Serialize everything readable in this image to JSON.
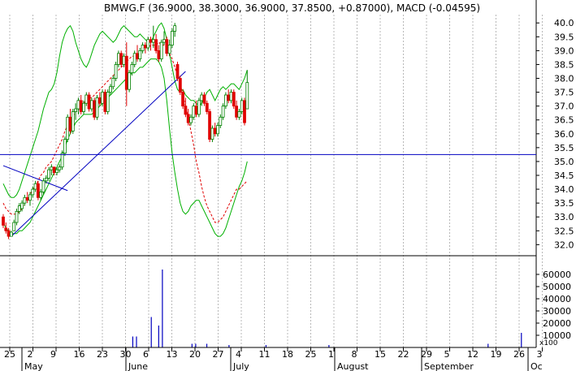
{
  "chart_data": {
    "type": "candlestick",
    "title": "BMWG.F (36.9000, 38.3000, 36.9000, 37.8500, +0.87000), MACD (-0.04595)",
    "ylim": [
      31.6,
      40.3
    ],
    "volume_ylim": [
      0,
      72000
    ],
    "volume_unit_label": "x100",
    "y_ticks": [
      "40.0",
      "39.5",
      "39.0",
      "38.5",
      "38.0",
      "37.5",
      "37.0",
      "36.5",
      "36.0",
      "35.5",
      "35.0",
      "34.5",
      "34.0",
      "33.5",
      "33.0",
      "32.5",
      "32.0"
    ],
    "volume_ticks": [
      "60000",
      "50000",
      "40000",
      "30000",
      "20000",
      "10000"
    ],
    "x_tick_labels": [
      "25",
      "2",
      "9",
      "16",
      "23",
      "30",
      "6",
      "13",
      "20",
      "27",
      "4",
      "11",
      "18",
      "25",
      "1",
      "8",
      "15",
      "22",
      "29",
      "5",
      "12",
      "19",
      "26",
      "3"
    ],
    "month_labels": [
      "May",
      "June",
      "July",
      "August",
      "September",
      "Oc"
    ],
    "horizontal_line": 35.25,
    "trend_lines": [
      {
        "from": [
          0,
          34.85
        ],
        "to": [
          24,
          33.95
        ],
        "color": "#0000c0"
      },
      {
        "from": [
          3,
          32.3
        ],
        "to": [
          68,
          38.25
        ],
        "color": "#0000c0"
      }
    ],
    "candles": [
      [
        33.0,
        33.1,
        32.6,
        32.7
      ],
      [
        32.6,
        32.8,
        32.4,
        32.5
      ],
      [
        32.5,
        32.6,
        32.2,
        32.3
      ],
      [
        32.3,
        32.5,
        32.3,
        32.45
      ],
      [
        32.5,
        32.9,
        32.5,
        32.8
      ],
      [
        32.8,
        33.3,
        32.7,
        33.2
      ],
      [
        33.2,
        33.5,
        33.1,
        33.4
      ],
      [
        33.3,
        33.6,
        33.2,
        33.5
      ],
      [
        33.5,
        33.8,
        33.4,
        33.7
      ],
      [
        33.7,
        33.9,
        33.5,
        33.6
      ],
      [
        33.6,
        33.9,
        33.4,
        33.8
      ],
      [
        33.8,
        34.1,
        33.7,
        34.0
      ],
      [
        34.0,
        34.3,
        33.9,
        34.2
      ],
      [
        34.2,
        34.3,
        33.6,
        33.7
      ],
      [
        33.7,
        34.0,
        33.6,
        33.9
      ],
      [
        33.9,
        34.4,
        33.8,
        34.3
      ],
      [
        34.3,
        34.5,
        34.2,
        34.4
      ],
      [
        34.4,
        34.8,
        34.3,
        34.7
      ],
      [
        34.7,
        34.9,
        34.5,
        34.8
      ],
      [
        34.8,
        34.8,
        34.5,
        34.6
      ],
      [
        34.6,
        34.8,
        34.5,
        34.7
      ],
      [
        34.7,
        34.9,
        34.6,
        34.8
      ],
      [
        34.8,
        35.4,
        34.7,
        35.3
      ],
      [
        35.3,
        35.9,
        35.2,
        35.8
      ],
      [
        35.8,
        36.7,
        35.7,
        36.6
      ],
      [
        36.6,
        36.9,
        36.0,
        36.1
      ],
      [
        36.1,
        36.9,
        36.0,
        36.8
      ],
      [
        36.8,
        37.1,
        36.5,
        36.9
      ],
      [
        36.9,
        37.3,
        36.7,
        37.2
      ],
      [
        37.2,
        37.4,
        36.7,
        36.8
      ],
      [
        36.8,
        37.2,
        36.7,
        37.1
      ],
      [
        37.1,
        37.5,
        37.0,
        37.4
      ],
      [
        37.4,
        37.5,
        36.8,
        36.9
      ],
      [
        36.9,
        37.3,
        36.8,
        37.2
      ],
      [
        37.2,
        37.3,
        36.5,
        36.6
      ],
      [
        36.6,
        37.4,
        36.5,
        37.3
      ],
      [
        37.3,
        37.5,
        37.0,
        37.1
      ],
      [
        37.1,
        37.6,
        37.0,
        37.5
      ],
      [
        37.5,
        37.6,
        36.7,
        36.8
      ],
      [
        36.8,
        37.6,
        36.7,
        37.5
      ],
      [
        37.5,
        37.8,
        37.4,
        37.7
      ],
      [
        37.7,
        38.1,
        37.6,
        38.0
      ],
      [
        38.0,
        38.6,
        37.9,
        38.5
      ],
      [
        38.5,
        39.0,
        38.4,
        38.9
      ],
      [
        38.9,
        39.0,
        38.4,
        38.5
      ],
      [
        38.5,
        38.9,
        38.4,
        38.8
      ],
      [
        38.8,
        39.3,
        37.0,
        37.6
      ],
      [
        37.6,
        38.3,
        37.5,
        38.2
      ],
      [
        38.2,
        38.6,
        38.1,
        38.5
      ],
      [
        38.5,
        39.0,
        38.4,
        38.9
      ],
      [
        38.9,
        39.2,
        38.6,
        38.7
      ],
      [
        38.7,
        39.1,
        38.6,
        39.0
      ],
      [
        39.0,
        39.3,
        38.9,
        39.2
      ],
      [
        39.2,
        39.3,
        38.9,
        39.1
      ],
      [
        39.1,
        39.5,
        39.0,
        39.4
      ],
      [
        39.4,
        39.5,
        39.0,
        39.3
      ],
      [
        39.3,
        39.9,
        39.1,
        39.4
      ],
      [
        39.4,
        39.6,
        38.9,
        39.0
      ],
      [
        39.0,
        39.2,
        38.6,
        38.7
      ],
      [
        38.7,
        39.4,
        38.6,
        39.3
      ],
      [
        39.3,
        39.7,
        39.2,
        39.4
      ],
      [
        39.4,
        39.5,
        38.8,
        38.9
      ],
      [
        38.9,
        39.4,
        38.8,
        39.2
      ],
      [
        39.2,
        39.8,
        39.1,
        39.7
      ],
      [
        39.7,
        40.0,
        39.5,
        39.9
      ],
      [
        38.5,
        38.6,
        37.9,
        38.0
      ],
      [
        38.0,
        38.1,
        37.4,
        37.5
      ],
      [
        37.5,
        37.6,
        36.9,
        37.0
      ],
      [
        37.0,
        37.3,
        36.6,
        36.7
      ],
      [
        36.7,
        36.9,
        36.3,
        36.4
      ],
      [
        36.4,
        36.7,
        36.3,
        36.6
      ],
      [
        36.6,
        37.1,
        36.5,
        37.0
      ],
      [
        37.0,
        37.2,
        36.6,
        36.7
      ],
      [
        36.7,
        37.3,
        36.6,
        37.2
      ],
      [
        37.2,
        37.5,
        37.0,
        37.4
      ],
      [
        37.4,
        37.5,
        37.0,
        37.1
      ],
      [
        37.1,
        37.2,
        36.7,
        36.8
      ],
      [
        36.8,
        36.9,
        35.7,
        35.8
      ],
      [
        35.8,
        36.3,
        35.7,
        36.2
      ],
      [
        36.2,
        36.4,
        35.9,
        36.0
      ],
      [
        36.0,
        36.4,
        35.9,
        36.3
      ],
      [
        36.3,
        36.7,
        36.2,
        36.6
      ],
      [
        36.6,
        37.1,
        36.5,
        37.0
      ],
      [
        37.0,
        37.5,
        36.9,
        37.4
      ],
      [
        37.4,
        37.6,
        37.1,
        37.2
      ],
      [
        37.2,
        37.6,
        37.1,
        37.5
      ],
      [
        37.5,
        37.6,
        36.9,
        37.0
      ],
      [
        37.0,
        37.2,
        36.5,
        36.6
      ],
      [
        36.6,
        36.9,
        36.5,
        36.8
      ],
      [
        36.8,
        37.3,
        36.7,
        37.2
      ],
      [
        37.2,
        37.3,
        36.3,
        36.4
      ],
      [
        36.9,
        38.3,
        36.9,
        37.85
      ]
    ],
    "upper_band": [
      34.2,
      34.0,
      33.8,
      33.7,
      33.7,
      33.8,
      34.0,
      34.3,
      34.6,
      34.9,
      35.2,
      35.5,
      35.8,
      36.1,
      36.5,
      36.9,
      37.2,
      37.5,
      37.6,
      37.8,
      38.2,
      38.8,
      39.3,
      39.6,
      39.8,
      39.9,
      39.7,
      39.3,
      39.0,
      38.7,
      38.5,
      38.4,
      38.6,
      38.9,
      39.2,
      39.4,
      39.6,
      39.7,
      39.6,
      39.5,
      39.4,
      39.3,
      39.4,
      39.6,
      39.8,
      39.9,
      39.8,
      39.7,
      39.6,
      39.5,
      39.5,
      39.6,
      39.5,
      39.4,
      39.3,
      39.3,
      39.5,
      39.7,
      39.9,
      40.0,
      39.8,
      39.4,
      38.9,
      38.4,
      37.9,
      37.6,
      37.5,
      37.6,
      37.4,
      37.3,
      37.2,
      37.2,
      37.1,
      37.0,
      37.1,
      37.3,
      37.5,
      37.6,
      37.4,
      37.2,
      37.4,
      37.6,
      37.7,
      37.6,
      37.7,
      37.8,
      37.8,
      37.7,
      37.6,
      37.8,
      38.0,
      38.3
    ],
    "middle_band": [
      33.5,
      33.3,
      33.2,
      33.1,
      33.1,
      33.1,
      33.2,
      33.3,
      33.5,
      33.6,
      33.8,
      34.0,
      34.1,
      34.3,
      34.5,
      34.6,
      34.8,
      34.9,
      35.0,
      35.2,
      35.4,
      35.6,
      35.8,
      36.1,
      36.3,
      36.5,
      36.6,
      36.8,
      36.9,
      37.0,
      37.1,
      37.2,
      37.3,
      37.3,
      37.4,
      37.5,
      37.6,
      37.7,
      37.8,
      37.9,
      38.0,
      38.1,
      38.2,
      38.3,
      38.4,
      38.5,
      38.6,
      38.7,
      38.8,
      38.8,
      38.9,
      39.0,
      39.0,
      39.1,
      39.1,
      39.2,
      39.2,
      39.2,
      39.3,
      39.2,
      39.2,
      39.1,
      38.9,
      38.7,
      38.4,
      38.1,
      37.8,
      37.4,
      37.0,
      36.6,
      36.1,
      35.6,
      35.0,
      34.6,
      34.1,
      33.7,
      33.4,
      33.2,
      33.0,
      32.8,
      32.8,
      32.9,
      33.0,
      33.2,
      33.4,
      33.6,
      33.8,
      34.0,
      34.0,
      34.1,
      34.2,
      34.3
    ],
    "lower_band": [
      32.8,
      32.6,
      32.5,
      32.4,
      32.4,
      32.4,
      32.5,
      32.5,
      32.6,
      32.7,
      32.8,
      33.0,
      33.2,
      33.4,
      33.6,
      33.8,
      34.0,
      34.2,
      34.4,
      34.6,
      34.8,
      35.0,
      35.2,
      35.5,
      35.8,
      36.0,
      36.2,
      36.4,
      36.5,
      36.6,
      36.7,
      36.7,
      36.7,
      36.7,
      36.8,
      36.9,
      37.0,
      37.1,
      37.2,
      37.3,
      37.4,
      37.5,
      37.6,
      37.7,
      37.8,
      37.9,
      38.0,
      38.1,
      38.2,
      38.2,
      38.3,
      38.4,
      38.4,
      38.5,
      38.6,
      38.7,
      38.7,
      38.7,
      38.6,
      38.4,
      38.0,
      37.2,
      36.2,
      35.3,
      34.6,
      34.0,
      33.5,
      33.2,
      33.1,
      33.2,
      33.4,
      33.5,
      33.6,
      33.6,
      33.4,
      33.2,
      33.0,
      32.8,
      32.6,
      32.4,
      32.3,
      32.3,
      32.4,
      32.6,
      32.9,
      33.2,
      33.5,
      33.8,
      34.1,
      34.3,
      34.6,
      35.0
    ],
    "volume": [
      0,
      0,
      0,
      0,
      0,
      0,
      0,
      0,
      0,
      0,
      0,
      0,
      0,
      0,
      0,
      0,
      0,
      0,
      0,
      0,
      0,
      0,
      0,
      0,
      0,
      0,
      0,
      0,
      0,
      0,
      0,
      0,
      0,
      0,
      0,
      9000,
      9000,
      0,
      0,
      0,
      25000,
      0,
      18000,
      64000,
      0,
      0,
      0,
      0,
      0,
      0,
      0,
      3000,
      3000,
      0,
      0,
      3000,
      0,
      0,
      0,
      0,
      0,
      2000,
      0,
      0,
      0,
      0,
      0,
      0,
      0,
      0,
      0,
      2000,
      0,
      0,
      0,
      0,
      0,
      0,
      0,
      0,
      0,
      0,
      0,
      0,
      0,
      0,
      0,
      0,
      2000,
      0,
      0,
      0,
      0,
      0,
      0,
      0,
      0,
      0,
      0,
      0,
      0,
      0,
      0,
      0,
      0,
      0,
      0,
      0,
      0,
      0,
      0,
      0,
      0,
      0,
      0,
      0,
      0,
      0,
      0,
      0,
      0,
      0,
      0,
      0,
      0,
      0,
      0,
      0,
      0,
      0,
      0,
      3000,
      0,
      0,
      0,
      0,
      0,
      0,
      0,
      0,
      12000,
      0,
      0,
      0
    ]
  }
}
